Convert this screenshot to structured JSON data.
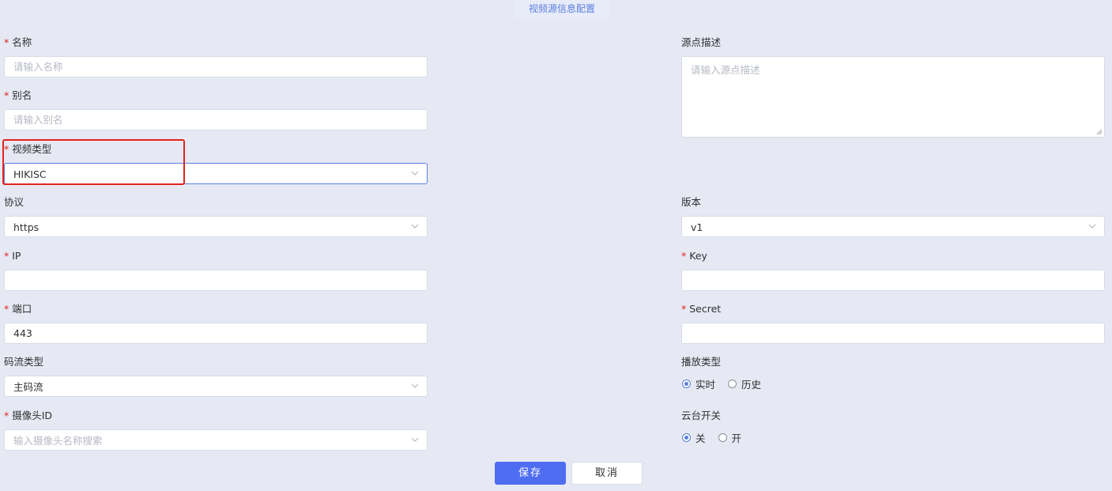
{
  "header": {
    "title": "视频源信息配置"
  },
  "form": {
    "name": {
      "label": "名称",
      "required": "*",
      "placeholder": "请输入名称"
    },
    "alias": {
      "label": "别名",
      "required": "*",
      "placeholder": "请输入别名"
    },
    "video_type": {
      "label": "视频类型",
      "required": "*",
      "value": "HIKISC"
    },
    "protocol": {
      "label": "协议",
      "value": "https"
    },
    "ip": {
      "label": "IP",
      "required": "*",
      "value": ""
    },
    "port": {
      "label": "端口",
      "required": "*",
      "value": "443"
    },
    "stream_type": {
      "label": "码流类型",
      "value": "主码流"
    },
    "camera_id": {
      "label": "摄像头ID",
      "required": "*",
      "placeholder": "输入摄像头名称搜索"
    },
    "description": {
      "label": "源点描述",
      "placeholder": "请输入源点描述"
    },
    "version": {
      "label": "版本",
      "value": "v1"
    },
    "key": {
      "label": "Key",
      "required": "*",
      "value": ""
    },
    "secret": {
      "label": "Secret",
      "required": "*",
      "value": ""
    },
    "play_type": {
      "label": "播放类型",
      "options": [
        "实时",
        "历史"
      ],
      "selected": "实时"
    },
    "ptz_switch": {
      "label": "云台开关",
      "options": [
        "关",
        "开"
      ],
      "selected": "关"
    }
  },
  "actions": {
    "save_label": "保存",
    "cancel_label": "取消"
  },
  "colors": {
    "accent": "#5b7fe0",
    "primary_button": "#4f6df0",
    "required": "#e02020",
    "highlight_box": "#e3241f"
  }
}
